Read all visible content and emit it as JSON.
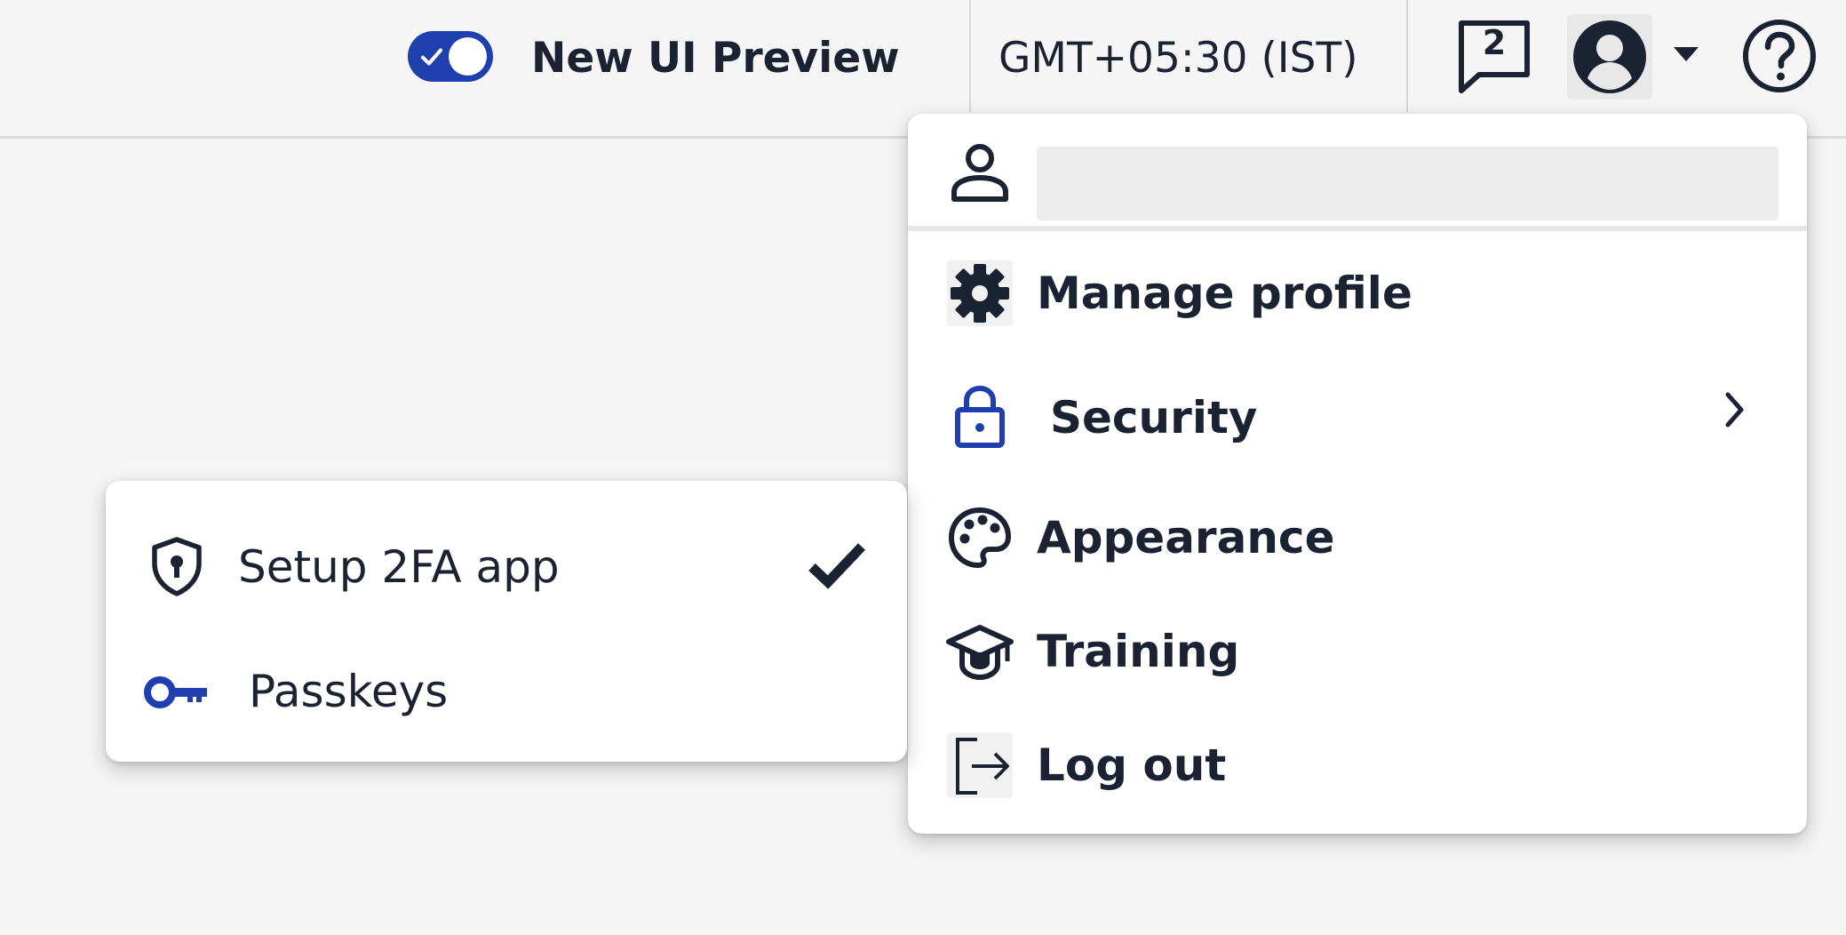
{
  "header": {
    "preview_toggle_label": "New UI Preview",
    "preview_toggle_on": true,
    "timezone": "GMT+05:30 (IST)",
    "notifications_count": "2"
  },
  "user_menu": {
    "items": [
      {
        "label": "Manage profile",
        "icon": "gear-icon"
      },
      {
        "label": "Security",
        "icon": "lock-icon",
        "has_submenu": true
      },
      {
        "label": "Appearance",
        "icon": "palette-icon"
      },
      {
        "label": "Training",
        "icon": "graduation-cap-icon"
      },
      {
        "label": "Log out",
        "icon": "logout-icon"
      }
    ]
  },
  "security_submenu": {
    "items": [
      {
        "label": "Setup 2FA app",
        "icon": "shield-keyhole-icon",
        "checked": true
      },
      {
        "label": "Passkeys",
        "icon": "key-icon"
      }
    ]
  },
  "colors": {
    "accent": "#1f3fae",
    "icon_dark": "#1b2232",
    "background": "#f5f5f5"
  }
}
